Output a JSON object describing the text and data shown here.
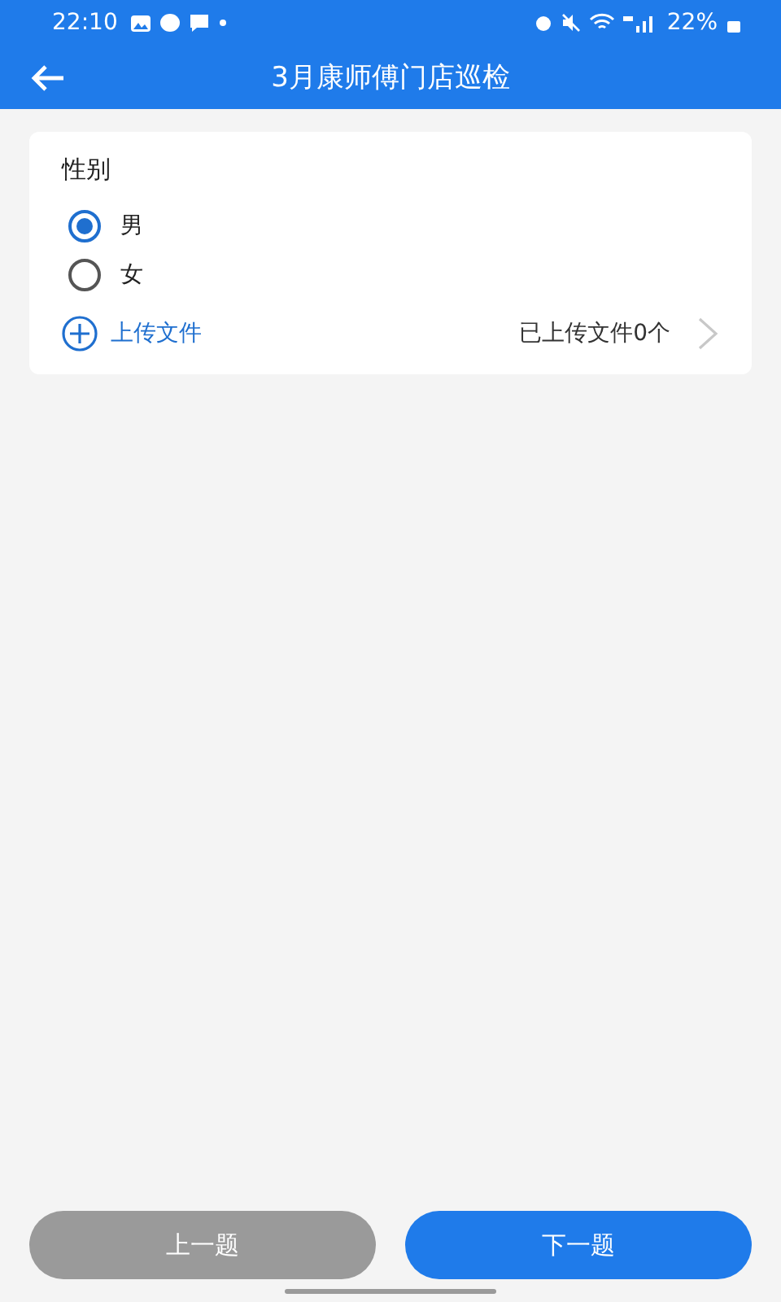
{
  "status_bar": {
    "time": "22:10",
    "battery": "22%"
  },
  "app_bar": {
    "title": "3月康师傅门店巡检"
  },
  "question": {
    "title": "性别",
    "options": [
      {
        "label": "男",
        "selected": true
      },
      {
        "label": "女",
        "selected": false
      }
    ],
    "upload": {
      "label": "上传文件",
      "count": "已上传文件0个"
    }
  },
  "buttons": [
    {
      "label": "上一题",
      "disabled": true
    },
    {
      "label": "下一题",
      "disabled": false
    }
  ]
}
